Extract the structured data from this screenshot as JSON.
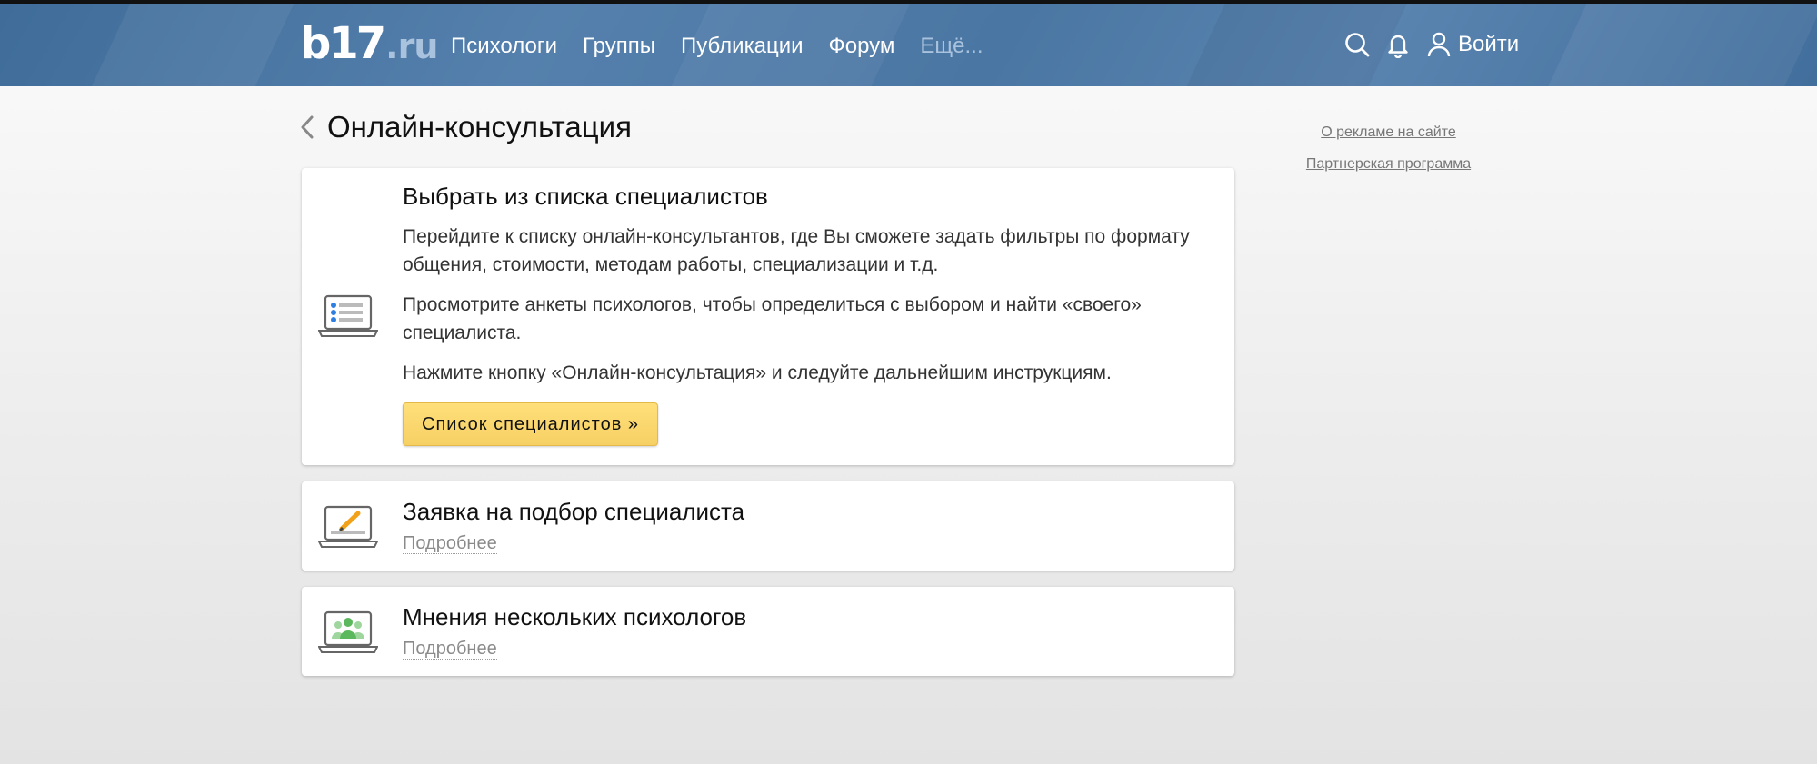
{
  "header": {
    "logo": {
      "main": "b17",
      "tld": ".ru"
    },
    "nav": [
      "Психологи",
      "Группы",
      "Публикации",
      "Форум",
      "Ещё..."
    ],
    "login_label": "Войти",
    "icons": [
      "search-icon",
      "bell-icon",
      "user-icon"
    ],
    "background_color": "#4a76a3"
  },
  "page": {
    "title": "Онлайн-консультация"
  },
  "cards": [
    {
      "title": "Выбрать из списка специалистов",
      "paragraphs": [
        "Перейдите к списку онлайн-консультантов, где Вы сможете задать фильтры по формату общения, стоимости, методам работы, специализации и т.д.",
        "Просмотрите анкеты психологов, чтобы определиться с выбором и найти «своего» специалиста.",
        "Нажмите кнопку «Онлайн-консультация» и следуйте дальнейшим инструкциям."
      ],
      "button_label": "Список специалистов »",
      "icon": "laptop-list-icon"
    },
    {
      "title": "Заявка на подбор специалиста",
      "more_label": "Подробнее",
      "icon": "laptop-pencil-icon"
    },
    {
      "title": "Мнения нескольких психологов",
      "more_label": "Подробнее",
      "icon": "laptop-group-icon"
    }
  ],
  "sidebar": {
    "links": [
      "О рекламе на сайте",
      "Партнерская программа"
    ]
  },
  "colors": {
    "button": "#ffdf7a",
    "accent_blue": "#2f7fe0",
    "accent_orange": "#f2a11a",
    "accent_green": "#6bc06b"
  }
}
